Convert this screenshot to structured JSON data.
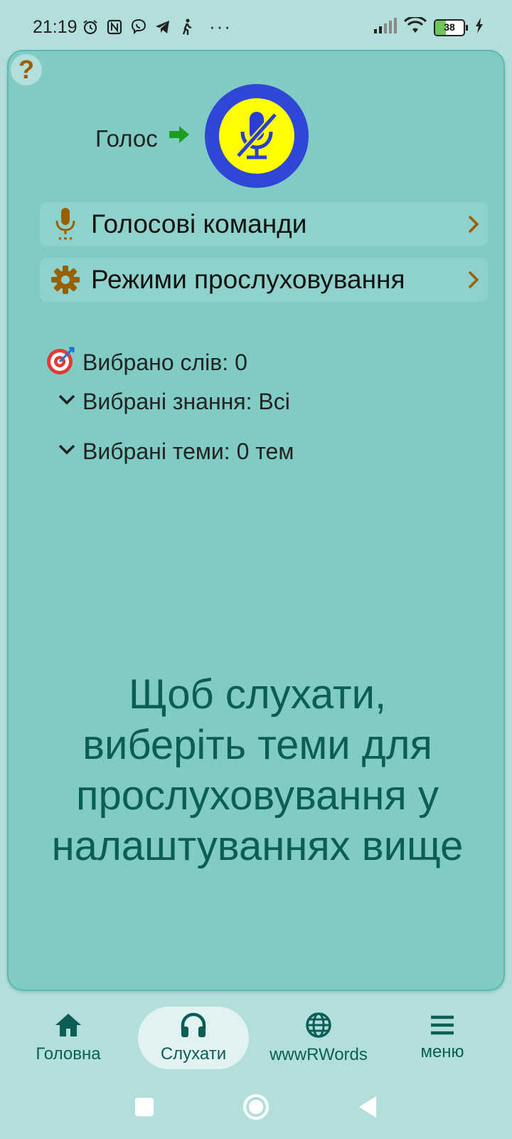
{
  "status_bar": {
    "time": "21:19",
    "icons": [
      "alarm-icon",
      "nfc-icon",
      "viber-icon",
      "telegram-icon",
      "walking-icon"
    ],
    "more": "···",
    "battery_level": "38",
    "battery_fraction": 0.38
  },
  "card": {
    "help": "?",
    "voice_label": "Голос",
    "mic_state": "muted",
    "voice_commands_label": "Голосові команди",
    "listening_modes_label": "Режими прослуховування",
    "selected_words": "Вибрано слів: 0",
    "selected_knowledge": "Вибрані знання: Всі",
    "selected_topics": "Вибрані теми: 0 тем",
    "hint_lines": [
      "Щоб слухати,",
      "виберіть теми для",
      "прослуховування у",
      "налаштуваннях вище"
    ]
  },
  "nav": {
    "items": [
      {
        "label": "Головна",
        "icon": "home-icon"
      },
      {
        "label": "Слухати",
        "icon": "headphones-icon",
        "active": true
      },
      {
        "label": "wwwRWords",
        "icon": "globe-icon"
      },
      {
        "label": "меню",
        "icon": "menu-icon"
      }
    ]
  },
  "colors": {
    "background": "#b2dfdb",
    "card": "#80cbc4",
    "accent_text": "#0b5e54",
    "mic_ring": "#2f47d6",
    "mic_fill": "#ffff00",
    "icon_brown": "#9a5f00",
    "arrow_green": "#1e9e1e"
  }
}
